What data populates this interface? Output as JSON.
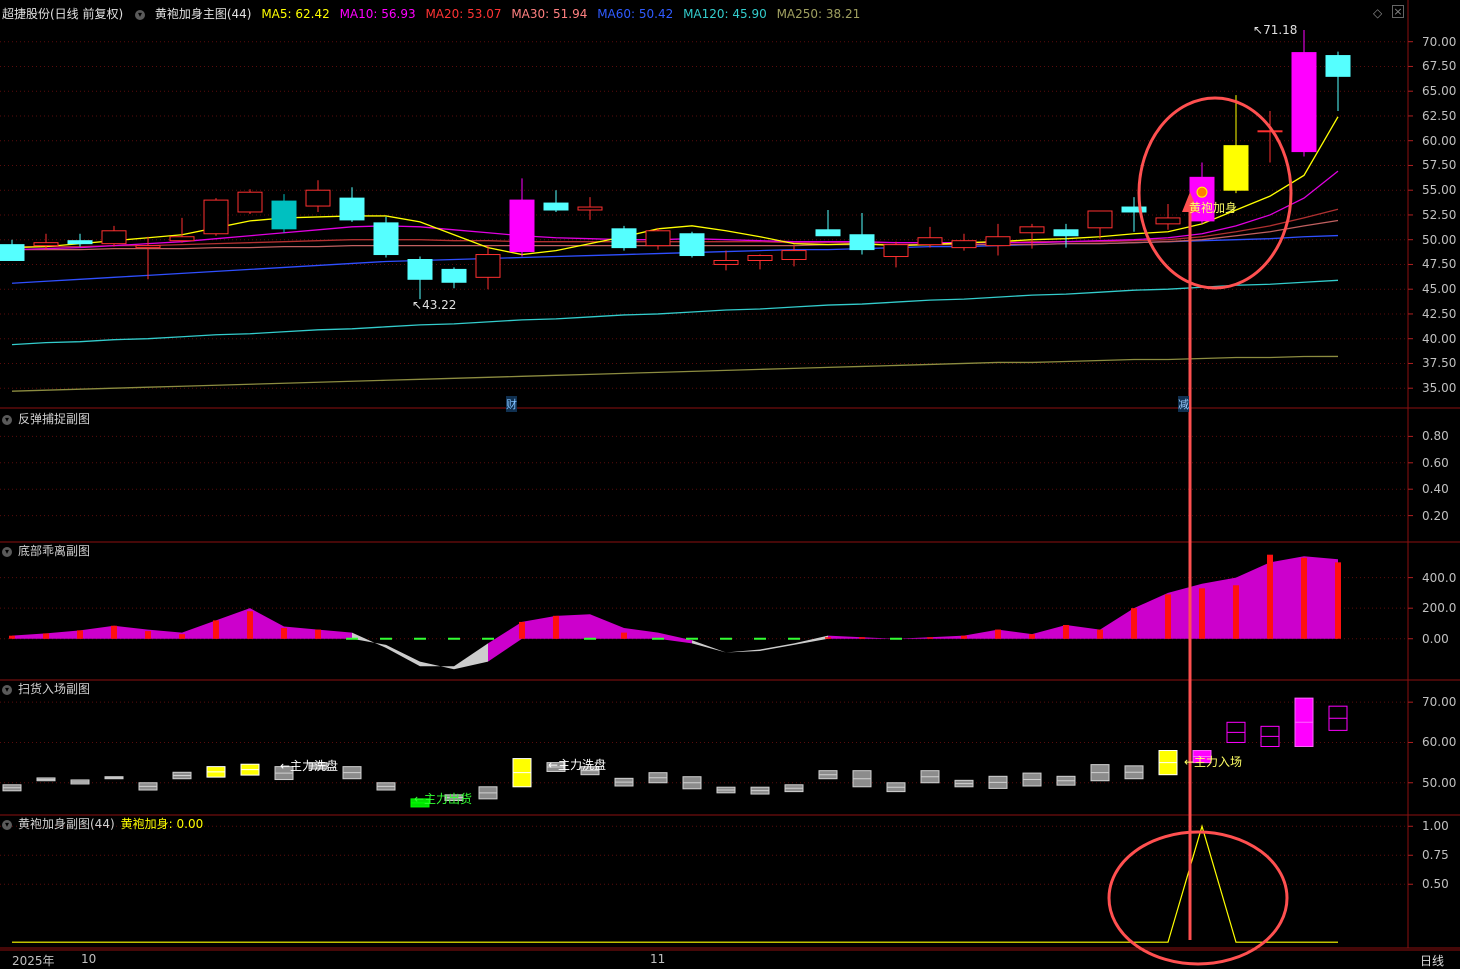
{
  "main_header": {
    "title": "超捷股份(日线 前复权)",
    "indicator": "黄袍加身主图(44)",
    "ma": [
      {
        "label": "MA5: 62.42",
        "color": "#ffff00"
      },
      {
        "label": "MA10: 56.93",
        "color": "#ff00ff"
      },
      {
        "label": "MA20: 53.07",
        "color": "#ff3333"
      },
      {
        "label": "MA30: 51.94",
        "color": "#ff8080"
      },
      {
        "label": "MA60: 50.42",
        "color": "#2f5bff"
      },
      {
        "label": "MA120: 45.90",
        "color": "#33cccc"
      },
      {
        "label": "MA250: 38.21",
        "color": "#a0a060"
      }
    ]
  },
  "panes": {
    "p2_title": "反弹捕捉副图",
    "p3_title": "底部乖离副图",
    "p4_title": "扫货入场副图",
    "p5_title": "黄袍加身副图(44)",
    "p5_value": "黄袍加身: 0.00"
  },
  "annotations": {
    "high": "71.18",
    "low": "43.22",
    "signal": "黄袍加身",
    "wash1": "←主力洗盘",
    "wash2": "←主力洗盘",
    "buy": "←主力出货",
    "enter": "←主力入场",
    "cai": "财",
    "jian": "减"
  },
  "x_axis": {
    "year": "2025年",
    "m10": "10",
    "m11": "11",
    "period": "日线"
  },
  "chart_data": [
    {
      "type": "candlestick",
      "title": "黄袍加身主图(44)",
      "ylim": [
        33,
        73
      ],
      "y_ticks": [
        "70.00",
        "67.50",
        "65.00",
        "62.50",
        "60.00",
        "57.50",
        "55.00",
        "52.50",
        "50.00",
        "47.50",
        "45.00",
        "42.50",
        "40.00",
        "37.50",
        "35.00"
      ],
      "candles": [
        {
          "o": 49.5,
          "h": 50.0,
          "l": 48.5,
          "c": 47.9
        },
        {
          "o": 49.4,
          "h": 50.6,
          "l": 49.0,
          "c": 49.7
        },
        {
          "o": 49.9,
          "h": 50.6,
          "l": 49.3,
          "c": 49.6
        },
        {
          "o": 49.6,
          "h": 51.4,
          "l": 49.3,
          "c": 50.9
        },
        {
          "o": 49.2,
          "h": 50.3,
          "l": 46.0,
          "c": 49.4
        },
        {
          "o": 49.9,
          "h": 52.2,
          "l": 49.7,
          "c": 50.3
        },
        {
          "o": 50.6,
          "h": 54.2,
          "l": 50.4,
          "c": 54.0
        },
        {
          "o": 52.8,
          "h": 55.1,
          "l": 52.6,
          "c": 54.8
        },
        {
          "o": 53.9,
          "h": 54.6,
          "l": 50.7,
          "c": 51.1
        },
        {
          "o": 53.4,
          "h": 56.0,
          "l": 52.8,
          "c": 55.0
        },
        {
          "o": 54.2,
          "h": 55.3,
          "l": 51.8,
          "c": 52.0
        },
        {
          "o": 51.7,
          "h": 52.3,
          "l": 48.2,
          "c": 48.5
        },
        {
          "o": 48.0,
          "h": 48.3,
          "l": 44.0,
          "c": 46.0
        },
        {
          "o": 47.0,
          "h": 47.2,
          "l": 45.1,
          "c": 45.7
        },
        {
          "o": 46.2,
          "h": 49.4,
          "l": 45.0,
          "c": 48.5
        },
        {
          "o": 48.8,
          "h": 56.2,
          "l": 48.3,
          "c": 54.0
        },
        {
          "o": 53.7,
          "h": 55.0,
          "l": 52.8,
          "c": 53.0
        },
        {
          "o": 53.0,
          "h": 54.3,
          "l": 52.0,
          "c": 53.3
        },
        {
          "o": 51.1,
          "h": 51.4,
          "l": 48.9,
          "c": 49.2
        },
        {
          "o": 49.4,
          "h": 51.2,
          "l": 49.0,
          "c": 50.9
        },
        {
          "o": 50.6,
          "h": 50.8,
          "l": 48.2,
          "c": 48.4
        },
        {
          "o": 47.5,
          "h": 48.9,
          "l": 46.9,
          "c": 47.9
        },
        {
          "o": 47.9,
          "h": 48.5,
          "l": 47.0,
          "c": 48.4
        },
        {
          "o": 48.0,
          "h": 49.5,
          "l": 47.3,
          "c": 48.9
        },
        {
          "o": 51.0,
          "h": 53.0,
          "l": 50.5,
          "c": 50.4
        },
        {
          "o": 50.5,
          "h": 52.7,
          "l": 48.5,
          "c": 49.0
        },
        {
          "o": 48.3,
          "h": 49.8,
          "l": 47.2,
          "c": 49.5
        },
        {
          "o": 49.5,
          "h": 51.3,
          "l": 49.2,
          "c": 50.2
        },
        {
          "o": 49.2,
          "h": 50.6,
          "l": 48.9,
          "c": 49.9
        },
        {
          "o": 49.4,
          "h": 51.6,
          "l": 48.4,
          "c": 50.3
        },
        {
          "o": 50.7,
          "h": 51.6,
          "l": 49.1,
          "c": 51.3
        },
        {
          "o": 51.0,
          "h": 51.6,
          "l": 49.2,
          "c": 50.4
        },
        {
          "o": 51.2,
          "h": 52.8,
          "l": 50.1,
          "c": 52.9
        },
        {
          "o": 53.3,
          "h": 54.3,
          "l": 50.8,
          "c": 52.8
        },
        {
          "o": 51.6,
          "h": 53.6,
          "l": 51.0,
          "c": 52.2
        },
        {
          "o": 51.9,
          "h": 57.8,
          "l": 51.6,
          "c": 56.3
        },
        {
          "o": 55.0,
          "h": 64.6,
          "l": 54.7,
          "c": 59.5
        },
        {
          "o": 61.0,
          "h": 63.0,
          "l": 57.8,
          "c": 61.0
        },
        {
          "o": 58.9,
          "h": 71.18,
          "l": 58.4,
          "c": 68.9
        },
        {
          "o": 68.6,
          "h": 69.0,
          "l": 63.0,
          "c": 66.5
        }
      ],
      "ma5": [
        49.2,
        49.3,
        49.6,
        49.9,
        50.2,
        50.5,
        51.2,
        51.9,
        52.2,
        52.3,
        52.4,
        52.4,
        51.8,
        50.5,
        49.2,
        48.5,
        48.9,
        49.6,
        50.3,
        51.1,
        51.4,
        50.9,
        50.3,
        49.6,
        49.5,
        49.6,
        49.4,
        49.5,
        49.7,
        49.8,
        50.0,
        50.1,
        50.3,
        50.6,
        50.8,
        51.6,
        53.0,
        54.4,
        56.5,
        62.42
      ],
      "ma10": [
        49.0,
        49.1,
        49.2,
        49.4,
        49.6,
        49.8,
        50.1,
        50.4,
        50.7,
        51.0,
        51.3,
        51.4,
        51.3,
        51.0,
        50.7,
        50.4,
        50.2,
        50.1,
        50.0,
        50.0,
        50.1,
        50.0,
        49.9,
        49.8,
        49.8,
        49.8,
        49.7,
        49.7,
        49.7,
        49.7,
        49.7,
        49.8,
        49.9,
        50.0,
        50.2,
        50.6,
        51.4,
        52.5,
        54.2,
        56.93
      ],
      "ma20": [
        49.3,
        49.3,
        49.3,
        49.4,
        49.4,
        49.5,
        49.6,
        49.7,
        49.8,
        49.9,
        50.0,
        50.0,
        50.0,
        49.9,
        49.9,
        49.8,
        49.8,
        49.8,
        49.8,
        49.8,
        49.8,
        49.8,
        49.8,
        49.7,
        49.7,
        49.7,
        49.7,
        49.7,
        49.7,
        49.7,
        49.8,
        49.8,
        49.8,
        49.9,
        50.0,
        50.3,
        50.8,
        51.4,
        52.2,
        53.07
      ],
      "ma30": [
        49.0,
        49.0,
        49.0,
        49.1,
        49.1,
        49.1,
        49.2,
        49.2,
        49.3,
        49.3,
        49.4,
        49.4,
        49.4,
        49.4,
        49.4,
        49.4,
        49.4,
        49.4,
        49.4,
        49.4,
        49.4,
        49.4,
        49.4,
        49.4,
        49.5,
        49.5,
        49.5,
        49.5,
        49.5,
        49.5,
        49.5,
        49.6,
        49.6,
        49.7,
        49.8,
        50.0,
        50.4,
        50.8,
        51.4,
        51.94
      ],
      "ma60": [
        45.6,
        45.8,
        46.0,
        46.2,
        46.4,
        46.6,
        46.8,
        47.0,
        47.2,
        47.4,
        47.6,
        47.8,
        47.9,
        48.0,
        48.1,
        48.2,
        48.3,
        48.4,
        48.5,
        48.6,
        48.7,
        48.8,
        48.9,
        49.0,
        49.0,
        49.1,
        49.2,
        49.3,
        49.3,
        49.4,
        49.5,
        49.6,
        49.6,
        49.7,
        49.8,
        49.9,
        50.0,
        50.1,
        50.3,
        50.42
      ],
      "ma120": [
        39.4,
        39.6,
        39.7,
        39.9,
        40.0,
        40.2,
        40.4,
        40.5,
        40.7,
        40.9,
        41.0,
        41.2,
        41.4,
        41.5,
        41.7,
        41.9,
        42.0,
        42.2,
        42.4,
        42.5,
        42.7,
        42.9,
        43.0,
        43.2,
        43.4,
        43.5,
        43.7,
        43.9,
        44.0,
        44.2,
        44.4,
        44.5,
        44.7,
        44.9,
        45.0,
        45.2,
        45.4,
        45.5,
        45.7,
        45.9
      ],
      "ma250": [
        34.7,
        34.8,
        34.9,
        35.0,
        35.1,
        35.2,
        35.3,
        35.4,
        35.5,
        35.6,
        35.7,
        35.8,
        35.9,
        36.0,
        36.1,
        36.2,
        36.3,
        36.4,
        36.5,
        36.6,
        36.7,
        36.8,
        36.9,
        37.0,
        37.1,
        37.2,
        37.3,
        37.4,
        37.5,
        37.6,
        37.6,
        37.7,
        37.8,
        37.9,
        37.9,
        38.0,
        38.1,
        38.1,
        38.2,
        38.21
      ]
    },
    {
      "type": "area",
      "title": "底部乖离副图",
      "y_ticks": [
        "400.0",
        "200.0",
        "0.00"
      ],
      "ylim": [
        -270,
        620
      ],
      "upper": [
        20,
        35,
        55,
        85,
        60,
        40,
        120,
        200,
        80,
        60,
        40,
        -60,
        -180,
        -180,
        -30,
        110,
        150,
        160,
        70,
        40,
        -10,
        -90,
        -70,
        -30,
        20,
        10,
        0,
        10,
        20,
        60,
        30,
        90,
        60,
        200,
        300,
        360,
        400,
        500,
        540,
        520
      ],
      "lower": [
        0,
        0,
        0,
        0,
        0,
        0,
        0,
        0,
        0,
        0,
        0,
        -40,
        -150,
        -200,
        -150,
        0,
        0,
        0,
        0,
        0,
        -30,
        -90,
        -80,
        -40,
        0,
        0,
        0,
        0,
        0,
        0,
        0,
        0,
        0,
        0,
        0,
        0,
        0,
        0,
        0,
        0
      ],
      "bars": [
        20,
        35,
        55,
        85,
        50,
        30,
        120,
        180,
        70,
        60,
        0,
        0,
        0,
        0,
        0,
        110,
        150,
        0,
        40,
        0,
        0,
        0,
        0,
        0,
        10,
        10,
        0,
        10,
        20,
        60,
        30,
        90,
        60,
        200,
        290,
        330,
        350,
        550,
        530,
        500
      ]
    },
    {
      "type": "bar",
      "title": "扫货入场副图",
      "y_ticks": [
        "70.00",
        "60.00",
        "50.00"
      ],
      "ylim": [
        42,
        75
      ],
      "boxes": [
        {
          "o": 49.5,
          "c": 48.0,
          "col": "gray"
        },
        {
          "o": 51.2,
          "c": 50.5,
          "col": "gray"
        },
        {
          "o": 50.7,
          "c": 49.7,
          "col": "gray"
        },
        {
          "o": 51.5,
          "c": 51.0,
          "col": "gray"
        },
        {
          "o": 50.0,
          "c": 48.2,
          "col": "gray"
        },
        {
          "o": 52.6,
          "c": 51.0,
          "col": "gray"
        },
        {
          "o": 54.0,
          "c": 51.4,
          "col": "yellow"
        },
        {
          "o": 54.6,
          "c": 51.9,
          "col": "yellow"
        },
        {
          "o": 54.0,
          "c": 50.8,
          "col": "gray"
        },
        {
          "o": 55.0,
          "c": 53.4,
          "col": "gray"
        },
        {
          "o": 54.0,
          "c": 51.0,
          "col": "gray"
        },
        {
          "o": 50.0,
          "c": 48.2,
          "col": "gray"
        },
        {
          "o": 46.0,
          "c": 44.0,
          "col": "green"
        },
        {
          "o": 47.0,
          "c": 45.6,
          "col": "gray"
        },
        {
          "o": 49.0,
          "c": 46.0,
          "col": "gray"
        },
        {
          "o": 56.0,
          "c": 49.0,
          "col": "yellow"
        },
        {
          "o": 55.0,
          "c": 52.8,
          "col": "gray"
        },
        {
          "o": 54.0,
          "c": 52.0,
          "col": "gray"
        },
        {
          "o": 51.1,
          "c": 49.2,
          "col": "gray"
        },
        {
          "o": 52.5,
          "c": 50.0,
          "col": "gray"
        },
        {
          "o": 51.5,
          "c": 48.5,
          "col": "gray"
        },
        {
          "o": 48.9,
          "c": 47.5,
          "col": "gray"
        },
        {
          "o": 48.9,
          "c": 47.2,
          "col": "gray"
        },
        {
          "o": 49.5,
          "c": 47.8,
          "col": "gray"
        },
        {
          "o": 53.0,
          "c": 51.0,
          "col": "gray"
        },
        {
          "o": 53.0,
          "c": 49.0,
          "col": "gray"
        },
        {
          "o": 50.0,
          "c": 47.8,
          "col": "gray"
        },
        {
          "o": 53.0,
          "c": 50.0,
          "col": "gray"
        },
        {
          "o": 50.6,
          "c": 49.0,
          "col": "gray"
        },
        {
          "o": 51.6,
          "c": 48.6,
          "col": "gray"
        },
        {
          "o": 52.4,
          "c": 49.2,
          "col": "gray"
        },
        {
          "o": 51.6,
          "c": 49.4,
          "col": "gray"
        },
        {
          "o": 54.5,
          "c": 50.5,
          "col": "gray"
        },
        {
          "o": 54.2,
          "c": 51.0,
          "col": "gray"
        },
        {
          "o": 58.0,
          "c": 52.0,
          "col": "yellow"
        },
        {
          "o": 58.0,
          "c": 55.0,
          "col": "magenta"
        },
        {
          "o": 65.0,
          "c": 60.0,
          "col": "magentaOutline"
        },
        {
          "o": 64.0,
          "c": 59.0,
          "col": "magentaOutline"
        },
        {
          "o": 71.0,
          "c": 59.0,
          "col": "magenta"
        },
        {
          "o": 69.0,
          "c": 63.0,
          "col": "magentaOutline"
        }
      ]
    },
    {
      "type": "line",
      "title": "黄袍加身副图(44)",
      "y_ticks": [
        "1.00",
        "0.75",
        "0.50"
      ],
      "ylim": [
        -0.05,
        1.08
      ],
      "values": [
        0,
        0,
        0,
        0,
        0,
        0,
        0,
        0,
        0,
        0,
        0,
        0,
        0,
        0,
        0,
        0,
        0,
        0,
        0,
        0,
        0,
        0,
        0,
        0,
        0,
        0,
        0,
        0,
        0,
        0,
        0,
        0,
        0,
        0,
        0,
        1,
        0,
        0,
        0,
        0
      ]
    }
  ]
}
